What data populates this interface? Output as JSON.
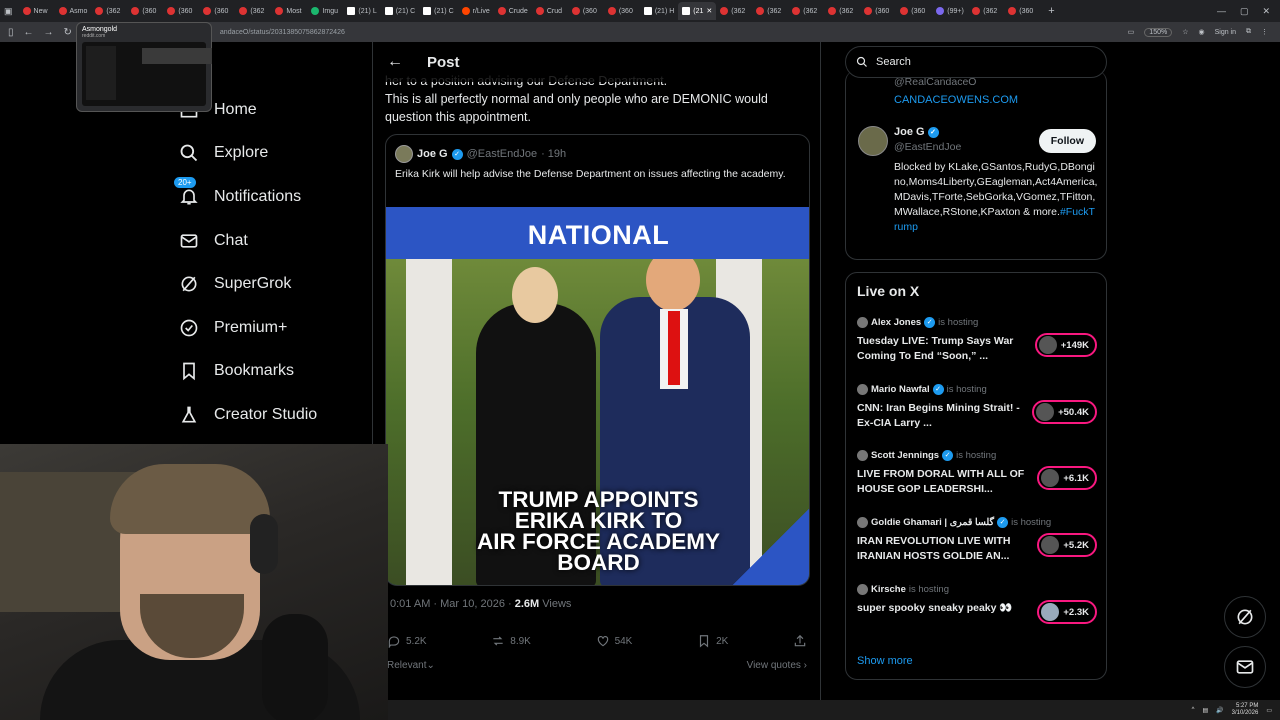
{
  "browser": {
    "tabs": [
      {
        "label": "New"
      },
      {
        "label": "Asmo"
      },
      {
        "label": "(362"
      },
      {
        "label": "(360"
      },
      {
        "label": "(360"
      },
      {
        "label": "(360"
      },
      {
        "label": "(362"
      },
      {
        "label": "Most"
      },
      {
        "label": "Imgu"
      },
      {
        "label": "(21) L"
      },
      {
        "label": "(21) C"
      },
      {
        "label": "(21) C"
      },
      {
        "label": "r/Live"
      },
      {
        "label": "Crude"
      },
      {
        "label": "Crud"
      },
      {
        "label": "(360"
      },
      {
        "label": "(360"
      },
      {
        "label": "(21) H"
      },
      {
        "label": "(21",
        "active": true
      },
      {
        "label": "(362"
      },
      {
        "label": "(362"
      },
      {
        "label": "(362"
      },
      {
        "label": "(362"
      },
      {
        "label": "(360"
      },
      {
        "label": "(360"
      },
      {
        "label": "(99+)"
      },
      {
        "label": "(362"
      },
      {
        "label": "(360"
      }
    ],
    "url": "andaceO/status/2031385075862872426",
    "zoom": "150%",
    "sign_in": "Sign in",
    "tooltip": {
      "title": "Asmongold",
      "domain": "reddit.com"
    }
  },
  "nav": {
    "items": [
      {
        "label": "Home",
        "icon": "home-icon"
      },
      {
        "label": "Explore",
        "icon": "search-icon"
      },
      {
        "label": "Notifications",
        "icon": "bell-icon",
        "badge": "20+"
      },
      {
        "label": "Chat",
        "icon": "mail-icon"
      },
      {
        "label": "SuperGrok",
        "icon": "grok-icon"
      },
      {
        "label": "Premium+",
        "icon": "verified-icon"
      },
      {
        "label": "Bookmarks",
        "icon": "bookmark-icon"
      },
      {
        "label": "Creator Studio",
        "icon": "flask-icon"
      }
    ]
  },
  "post": {
    "header_title": "Post",
    "text_line1": "her to a position advising our Defense Department.",
    "text_line2": "This is all perfectly normal and only people who are DEMONIC would question this appointment.",
    "quote": {
      "name": "Joe G",
      "handle": "@EastEndJoe",
      "time": "· 19h",
      "text": "Erika Kirk will help advise the Defense Department on issues affecting the academy.",
      "image_banner": "NATIONAL",
      "image_caption_1": "TRUMP APPOINTS",
      "image_caption_2": "ERIKA KIRK TO",
      "image_caption_3": "AIR FORCE ACADEMY",
      "image_caption_4": "BOARD"
    },
    "timestamp": "0:01 AM · Mar 10, 2026 · ",
    "views_count": "2.6M",
    "views_label": " Views",
    "stats": {
      "replies": "5.2K",
      "reposts": "8.9K",
      "likes": "54K",
      "bookmarks": "2K"
    },
    "sort_label": "Relevant",
    "view_quotes": "View quotes"
  },
  "right": {
    "search_placeholder": "Search",
    "prev_handle": "@RealCandaceO",
    "prev_link": "CANDACEOWENS.COM",
    "follow": {
      "name": "Joe G",
      "handle": "@EastEndJoe",
      "button": "Follow",
      "bio": "Blocked by KLake,GSantos,RudyG,DBongino,Moms4Liberty,GEagleman,Act4America,MDavis,TForte,SebGorka,VGomez,TFitton,MWallace,RStone,KPaxton & more.",
      "bio_tag": "#FuckTrump"
    },
    "live": {
      "title": "Live on X",
      "is_hosting": "is hosting",
      "items": [
        {
          "host": "Alex Jones",
          "title": "Tuesday LIVE: Trump Says War Coming To End “Soon,” ...",
          "count": "+149K"
        },
        {
          "host": "Mario Nawfal",
          "title": "CNN: Iran Begins Mining Strait! - Ex-CIA Larry ...",
          "count": "+50.4K"
        },
        {
          "host": "Scott Jennings",
          "title": "LIVE FROM DORAL WITH ALL OF HOUSE GOP LEADERSHI...",
          "count": "+6.1K"
        },
        {
          "host": "Goldie Ghamari | گلسا قمری",
          "title": "IRAN REVOLUTION LIVE WITH IRANIAN HOSTS GOLDIE AN...",
          "count": "+5.2K"
        },
        {
          "host": "Kirsche",
          "title": "super spooky sneaky peaky 👀",
          "count": "+2.3K"
        }
      ],
      "show_more": "Show more"
    }
  },
  "taskbar": {
    "time": "5:27 PM",
    "date": "3/10/2026"
  },
  "colors": {
    "accent": "#1d9bf0",
    "live": "#f91880",
    "background": "#000000"
  }
}
